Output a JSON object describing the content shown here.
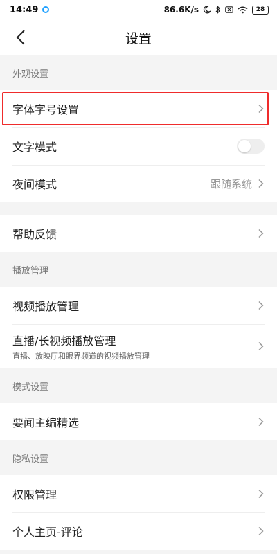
{
  "status_bar": {
    "time": "14:49",
    "network_speed": "86.6K/s",
    "battery": "28"
  },
  "header": {
    "title": "设置"
  },
  "sections": {
    "appearance": {
      "label": "外观设置",
      "font_size": "字体字号设置",
      "text_mode": "文字模式",
      "night_mode": "夜间模式",
      "night_mode_value": "跟随系统"
    },
    "feedback": {
      "help": "帮助反馈"
    },
    "playback": {
      "label": "播放管理",
      "video": "视频播放管理",
      "live": "直播/长视频播放管理",
      "live_desc": "直播、放映厅和眼界频道的视频播放管理"
    },
    "mode": {
      "label": "模式设置",
      "editor_picks": "要闻主编精选"
    },
    "privacy": {
      "label": "隐私设置",
      "permissions": "权限管理",
      "profile_comments": "个人主页-评论"
    }
  },
  "colors": {
    "highlight_border": "#ef2c2c",
    "toggle_off": "#eeeeee"
  }
}
